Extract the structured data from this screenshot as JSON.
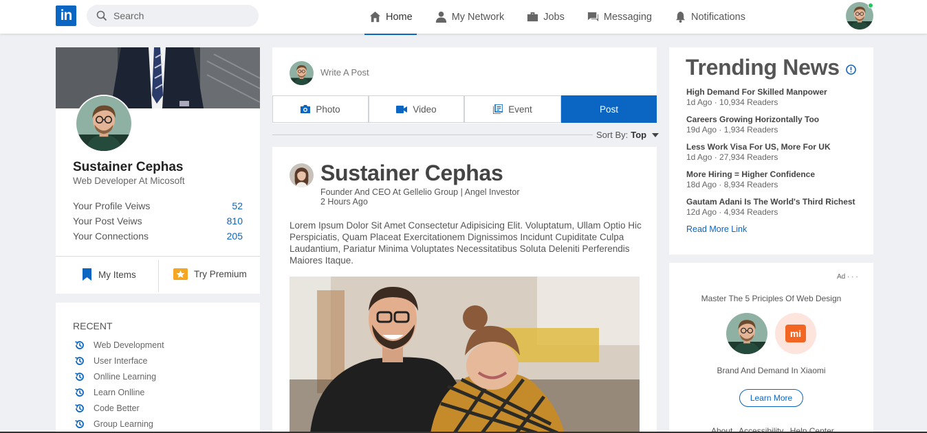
{
  "nav": {
    "logo": "in",
    "search_placeholder": "Search",
    "items": [
      {
        "label": "Home",
        "icon": "home-icon",
        "active": true
      },
      {
        "label": "My Network",
        "icon": "people-icon",
        "active": false
      },
      {
        "label": "Jobs",
        "icon": "briefcase-icon",
        "active": false
      },
      {
        "label": "Messaging",
        "icon": "chat-icon",
        "active": false
      },
      {
        "label": "Notifications",
        "icon": "bell-icon",
        "active": false
      }
    ]
  },
  "profile": {
    "name": "Sustainer Cephas",
    "title": "Web Developer At Micosoft",
    "stats": [
      {
        "label": "Your Profile Veiws",
        "value": "52"
      },
      {
        "label": "Your Post Veiws",
        "value": "810"
      },
      {
        "label": "Your Connections",
        "value": "205"
      }
    ],
    "my_items_label": "My Items",
    "premium_label": "Try Premium"
  },
  "recent": {
    "title": "RECENT",
    "items": [
      "Web Development",
      "User Interface",
      "Onlline Learning",
      "Learn Onlline",
      "Code Better",
      "Group Learning"
    ]
  },
  "composer": {
    "placeholder": "Write A Post",
    "photo": "Photo",
    "video": "Video",
    "event": "Event",
    "post": "Post",
    "sort_label": "Sort By:",
    "sort_value": "Top"
  },
  "post": {
    "author": "Sustainer Cephas",
    "subtitle": "Founder And CEO At Gellelio Group | Angel Investor",
    "time": "2 Hours Ago",
    "body": "Lorem Ipsum Dolor Sit Amet Consectetur Adipisicing Elit. Voluptatum, Ullam Optio Hic Perspiciatis, Quam Placeat Exercitationem Dignissimos Incidunt Cupiditate Culpa Laudantium, Pariatur Minima Voluptates Necessitatibus Soluta Deleniti Perferendis Maiores Itaque."
  },
  "trending": {
    "title": "Trending News",
    "items": [
      {
        "title": "High Demand For Skilled Manpower",
        "meta": "1d Ago · 10,934 Readers"
      },
      {
        "title": "Careers Growing Horizontally Too",
        "meta": "19d Ago · 1,934 Readers"
      },
      {
        "title": "Less Work Visa For US, More For UK",
        "meta": "1d Ago · 27,934 Readers"
      },
      {
        "title": "More Hiring = Higher Confidence",
        "meta": "18d Ago · 8,934 Readers"
      },
      {
        "title": "Gautam Adani Is The World's Third Richest",
        "meta": "12d Ago · 4,934 Readers"
      }
    ],
    "read_more": "Read More Link"
  },
  "ad": {
    "label": "Ad · · ·",
    "headline": "Master The 5 Priciples Of Web Design",
    "company": "Brand And Demand In Xiaomi",
    "logo_text": "mi",
    "cta": "Learn More",
    "footer_links": [
      "About",
      "Accessibility",
      "Help Center"
    ]
  },
  "colors": {
    "brand": "#0a66c2",
    "online": "#22c55e",
    "premium": "#f5a623",
    "xiaomi": "#f26522"
  }
}
